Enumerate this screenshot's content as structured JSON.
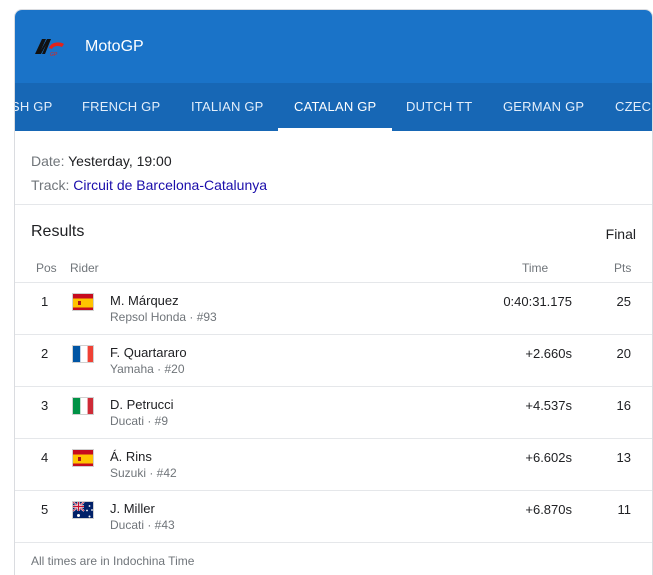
{
  "header": {
    "title": "MotoGP",
    "logo_icon": "motogp-logo-icon"
  },
  "tabs": [
    {
      "label": "SH GP",
      "active": false
    },
    {
      "label": "FRENCH GP",
      "active": false
    },
    {
      "label": "ITALIAN GP",
      "active": false
    },
    {
      "label": "CATALAN GP",
      "active": true
    },
    {
      "label": "DUTCH TT",
      "active": false
    },
    {
      "label": "GERMAN GP",
      "active": false
    },
    {
      "label": "CZECH",
      "active": false
    }
  ],
  "event": {
    "date_label": "Date:",
    "date_value": "Yesterday, 19:00",
    "track_label": "Track:",
    "track_value": "Circuit de Barcelona-Catalunya"
  },
  "results": {
    "title": "Results",
    "status": "Final",
    "columns": {
      "pos": "Pos",
      "rider": "Rider",
      "time": "Time",
      "pts": "Pts"
    },
    "rows": [
      {
        "pos": "1",
        "flag": "spain-flag-icon",
        "name": "M. Márquez",
        "team": "Repsol Honda · #93",
        "time": "0:40:31.175",
        "pts": "25"
      },
      {
        "pos": "2",
        "flag": "france-flag-icon",
        "name": "F. Quartararo",
        "team": "Yamaha · #20",
        "time": "+2.660s",
        "pts": "20"
      },
      {
        "pos": "3",
        "flag": "italy-flag-icon",
        "name": "D. Petrucci",
        "team": "Ducati · #9",
        "time": "+4.537s",
        "pts": "16"
      },
      {
        "pos": "4",
        "flag": "spain-flag-icon",
        "name": "Á. Rins",
        "team": "Suzuki · #42",
        "time": "+6.602s",
        "pts": "13"
      },
      {
        "pos": "5",
        "flag": "australia-flag-icon",
        "name": "J. Miller",
        "team": "Ducati · #43",
        "time": "+6.870s",
        "pts": "11"
      }
    ]
  },
  "footer": {
    "note": "All times are in Indochina Time"
  },
  "colors": {
    "header_bg": "#1a73c8",
    "tabs_bg": "#1767b5",
    "link": "#1a0dab"
  }
}
